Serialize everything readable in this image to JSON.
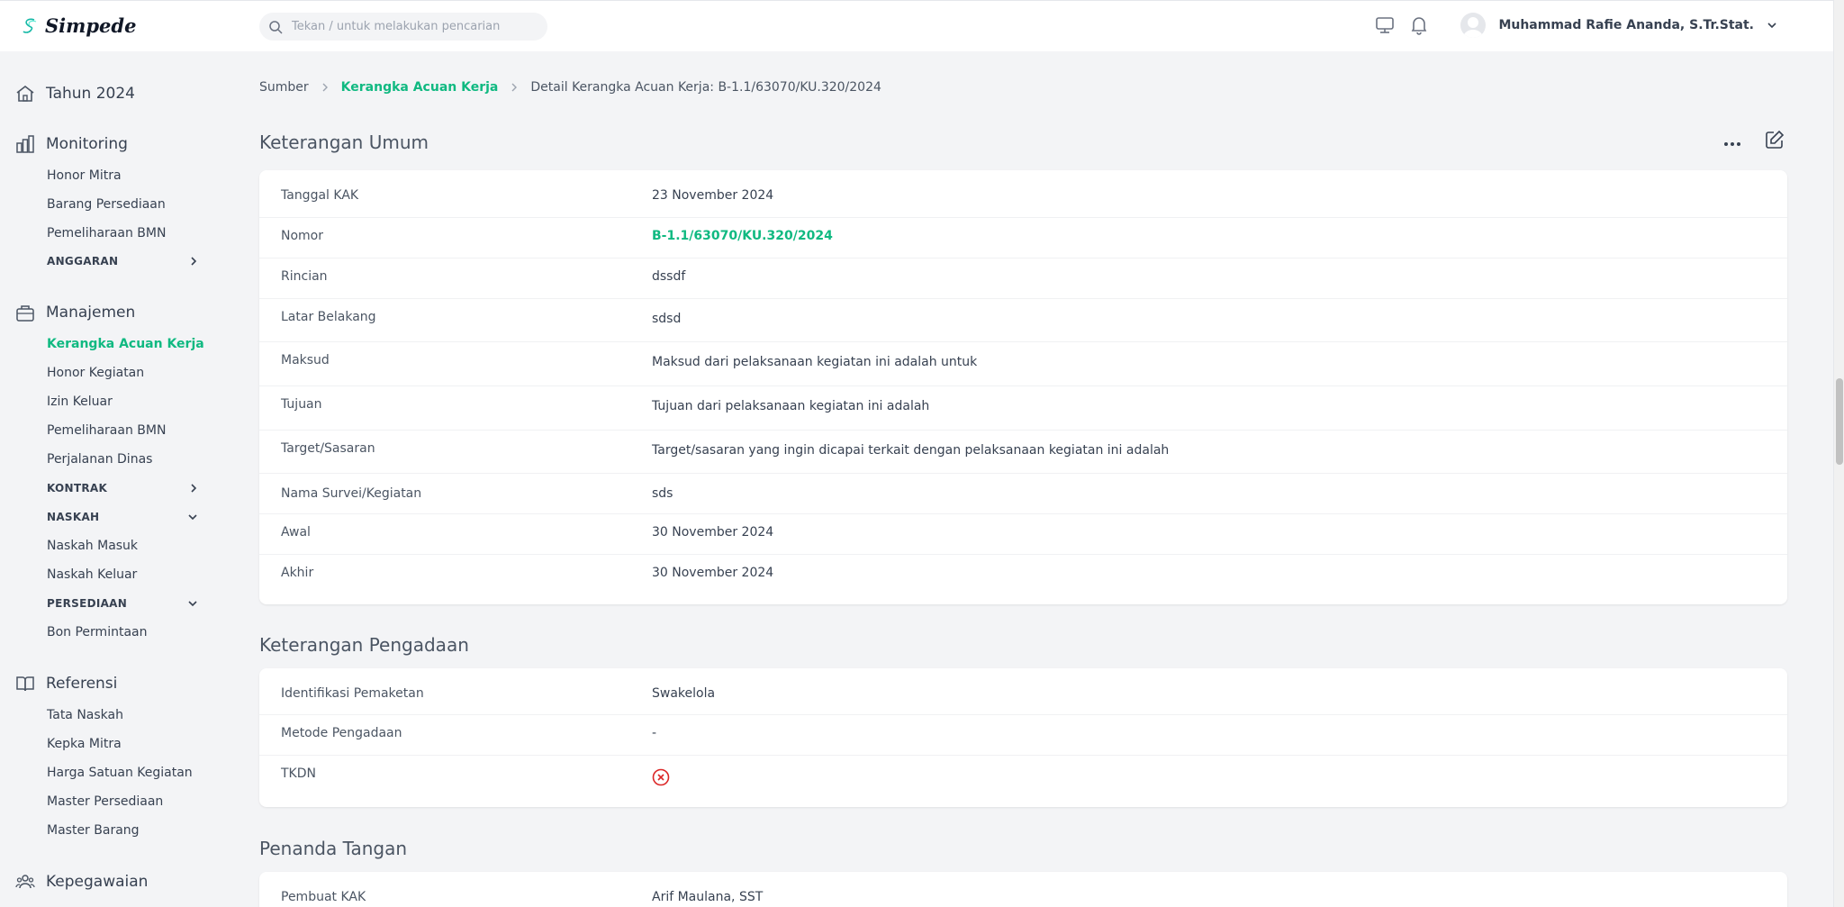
{
  "app": {
    "name": "Simpede"
  },
  "search": {
    "placeholder": "Tekan / untuk melakukan pencarian"
  },
  "user": {
    "name": "Muhammad Rafie Ananda, S.Tr.Stat."
  },
  "sidebar": {
    "year": "Tahun 2024",
    "monitoring": {
      "label": "Monitoring",
      "items": [
        "Honor Mitra",
        "Barang Persediaan",
        "Pemeliharaan BMN"
      ],
      "group": "ANGGARAN"
    },
    "manajemen": {
      "label": "Manajemen",
      "items": [
        "Kerangka Acuan Kerja",
        "Honor Kegiatan",
        "Izin Keluar",
        "Pemeliharaan BMN",
        "Perjalanan Dinas"
      ],
      "group_kontrak": "KONTRAK",
      "group_naskah": "NASKAH",
      "naskah_items": [
        "Naskah Masuk",
        "Naskah Keluar"
      ],
      "group_persediaan": "PERSEDIAAN",
      "persediaan_items": [
        "Bon Permintaan"
      ]
    },
    "referensi": {
      "label": "Referensi",
      "items": [
        "Tata Naskah",
        "Kepka Mitra",
        "Harga Satuan Kegiatan",
        "Master Persediaan",
        "Master Barang"
      ]
    },
    "kepegawaian": {
      "label": "Kepegawaian"
    }
  },
  "breadcrumb": {
    "root": "Sumber",
    "parent": "Kerangka Acuan Kerja",
    "current": "Detail Kerangka Acuan Kerja: B-1.1/63070/KU.320/2024"
  },
  "umum": {
    "title": "Keterangan Umum",
    "rows": [
      {
        "k": "Tanggal KAK",
        "v": "23 November 2024"
      },
      {
        "k": "Nomor",
        "v": "B-1.1/63070/KU.320/2024"
      },
      {
        "k": "Rincian",
        "v": "dssdf"
      },
      {
        "k": "Latar Belakang",
        "v": "sdsd"
      },
      {
        "k": "Maksud",
        "v": "Maksud dari pelaksanaan kegiatan ini adalah untuk"
      },
      {
        "k": "Tujuan",
        "v": "Tujuan dari pelaksanaan kegiatan ini adalah"
      },
      {
        "k": "Target/Sasaran",
        "v": "Target/sasaran yang ingin dicapai terkait dengan pelaksanaan kegiatan ini adalah"
      },
      {
        "k": "Nama Survei/Kegiatan",
        "v": "sds"
      },
      {
        "k": "Awal",
        "v": "30 November 2024"
      },
      {
        "k": "Akhir",
        "v": "30 November 2024"
      }
    ]
  },
  "pengadaan": {
    "title": "Keterangan Pengadaan",
    "rows": [
      {
        "k": "Identifikasi Pemaketan",
        "v": "Swakelola"
      },
      {
        "k": "Metode Pengadaan",
        "v": "-"
      },
      {
        "k": "TKDN",
        "v": ""
      }
    ]
  },
  "penanda": {
    "title": "Penanda Tangan",
    "rows": [
      {
        "k": "Pembuat KAK",
        "v": "Arif Maulana, SST"
      }
    ]
  },
  "colors": {
    "accent": "#10b981",
    "danger": "#dc2626"
  }
}
